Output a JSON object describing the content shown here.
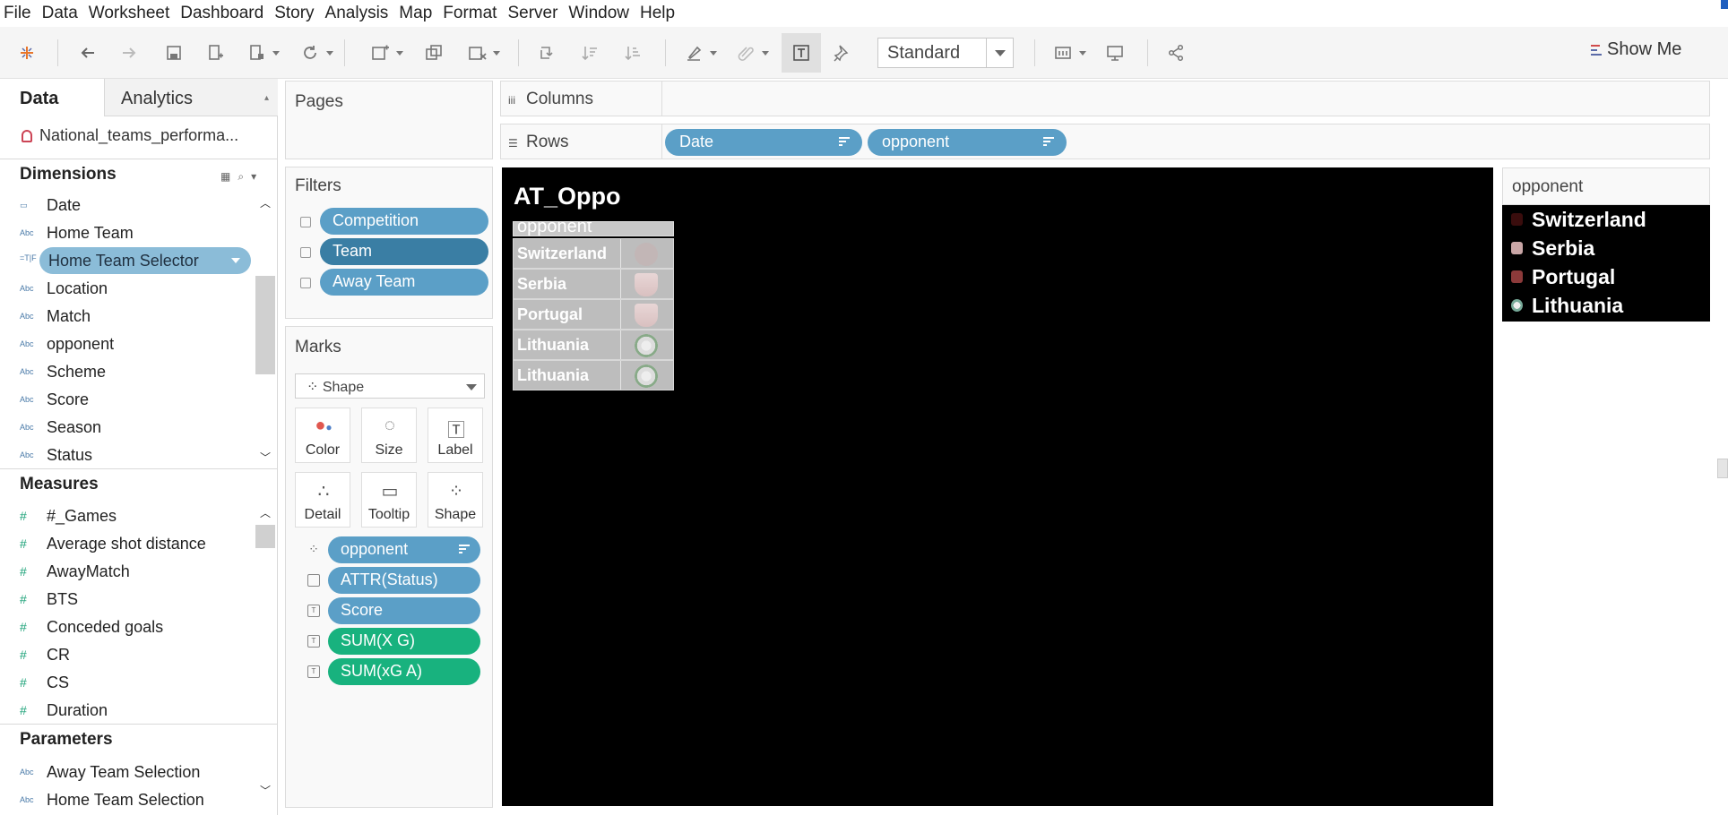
{
  "menu": [
    "File",
    "Data",
    "Worksheet",
    "Dashboard",
    "Story",
    "Analysis",
    "Map",
    "Format",
    "Server",
    "Window",
    "Help"
  ],
  "toolbar": {
    "view_size": "Standard",
    "show_me": "Show Me"
  },
  "data_pane": {
    "tabs": [
      "Data",
      "Analytics"
    ],
    "datasource": "National_teams_performa...",
    "dimensions_header": "Dimensions",
    "dimensions": [
      {
        "label": "Date",
        "icon": "calendar-icon"
      },
      {
        "label": "Home Team",
        "icon": "abc-icon"
      },
      {
        "label": "Home Team Selector",
        "icon": "calc-icon",
        "selected": true
      },
      {
        "label": "Location",
        "icon": "abc-icon"
      },
      {
        "label": "Match",
        "icon": "abc-icon"
      },
      {
        "label": "opponent",
        "icon": "abc-icon"
      },
      {
        "label": "Scheme",
        "icon": "abc-icon"
      },
      {
        "label": "Score",
        "icon": "abc-icon"
      },
      {
        "label": "Season",
        "icon": "abc-icon"
      },
      {
        "label": "Status",
        "icon": "abc-icon"
      }
    ],
    "measures_header": "Measures",
    "measures": [
      "#_Games",
      "Average shot distance",
      "AwayMatch",
      "BTS",
      "Conceded goals",
      "CR",
      "CS",
      "Duration"
    ],
    "parameters_header": "Parameters",
    "parameters": [
      "Away Team Selection",
      "Home Team Selection"
    ]
  },
  "pages": {
    "title": "Pages"
  },
  "filters": {
    "title": "Filters",
    "items": [
      "Competition",
      "Team",
      "Away Team"
    ]
  },
  "marks": {
    "title": "Marks",
    "type": "Shape",
    "buttons": [
      "Color",
      "Size",
      "Label",
      "Detail",
      "Tooltip",
      "Shape"
    ],
    "fields": [
      {
        "label": "opponent",
        "kind": "dimension",
        "icon": "shape-icon"
      },
      {
        "label": "ATTR(Status)",
        "kind": "dimension",
        "icon": "tooltip-icon"
      },
      {
        "label": "Score",
        "kind": "dimension",
        "icon": "text-icon"
      },
      {
        "label": "SUM(X G)",
        "kind": "measure",
        "icon": "text-icon"
      },
      {
        "label": "SUM(xG A)",
        "kind": "measure",
        "icon": "text-icon"
      }
    ]
  },
  "shelves": {
    "columns_label": "Columns",
    "rows_label": "Rows",
    "rows": [
      "Date",
      "opponent"
    ]
  },
  "viz": {
    "title": "AT_Oppo",
    "header": "opponent",
    "rows": [
      "Switzerland",
      "Serbia",
      "Portugal",
      "Lithuania",
      "Lithuania"
    ]
  },
  "legend": {
    "title": "opponent",
    "items": [
      "Switzerland",
      "Serbia",
      "Portugal",
      "Lithuania"
    ]
  },
  "colors": {
    "dimension_pill": "#5b9fc7",
    "measure_pill": "#18b27e",
    "canvas": "#000000"
  }
}
